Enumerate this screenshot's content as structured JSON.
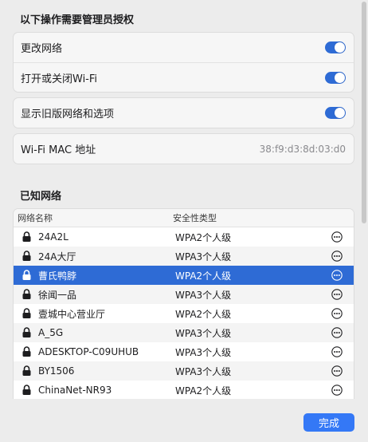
{
  "admin_section": {
    "title": "以下操作需要管理员授权",
    "rows": [
      {
        "label": "更改网络",
        "toggle_on": true
      },
      {
        "label": "打开或关闭Wi-Fi",
        "toggle_on": true
      }
    ]
  },
  "legacy_section": {
    "label": "显示旧版网络和选项",
    "toggle_on": true
  },
  "mac_section": {
    "label": "Wi-Fi MAC 地址",
    "value": "38:f9:d3:8d:03:d0"
  },
  "known_networks": {
    "title": "已知网络",
    "columns": {
      "name": "网络名称",
      "security": "安全性类型"
    },
    "rows": [
      {
        "name": "24A2L",
        "security": "WPA2个人级"
      },
      {
        "name": "24A大厅",
        "security": "WPA3个人级"
      },
      {
        "name": "曹氏鸭脖",
        "security": "WPA2个人级",
        "selected": true
      },
      {
        "name": "徐闻一品",
        "security": "WPA3个人级"
      },
      {
        "name": "壹城中心营业厅",
        "security": "WPA2个人级"
      },
      {
        "name": "A_5G",
        "security": "WPA3个人级"
      },
      {
        "name": "ADESKTOP-C09UHUB",
        "security": "WPA3个人级"
      },
      {
        "name": "BY1506",
        "security": "WPA3个人级"
      },
      {
        "name": "ChinaNet-NR93",
        "security": "WPA2个人级"
      }
    ]
  },
  "footer": {
    "done_label": "完成"
  },
  "colors": {
    "accent": "#2e6bd5",
    "button": "#3478f6"
  },
  "icons": {
    "lock": "lock-icon",
    "more": "more-icon"
  }
}
